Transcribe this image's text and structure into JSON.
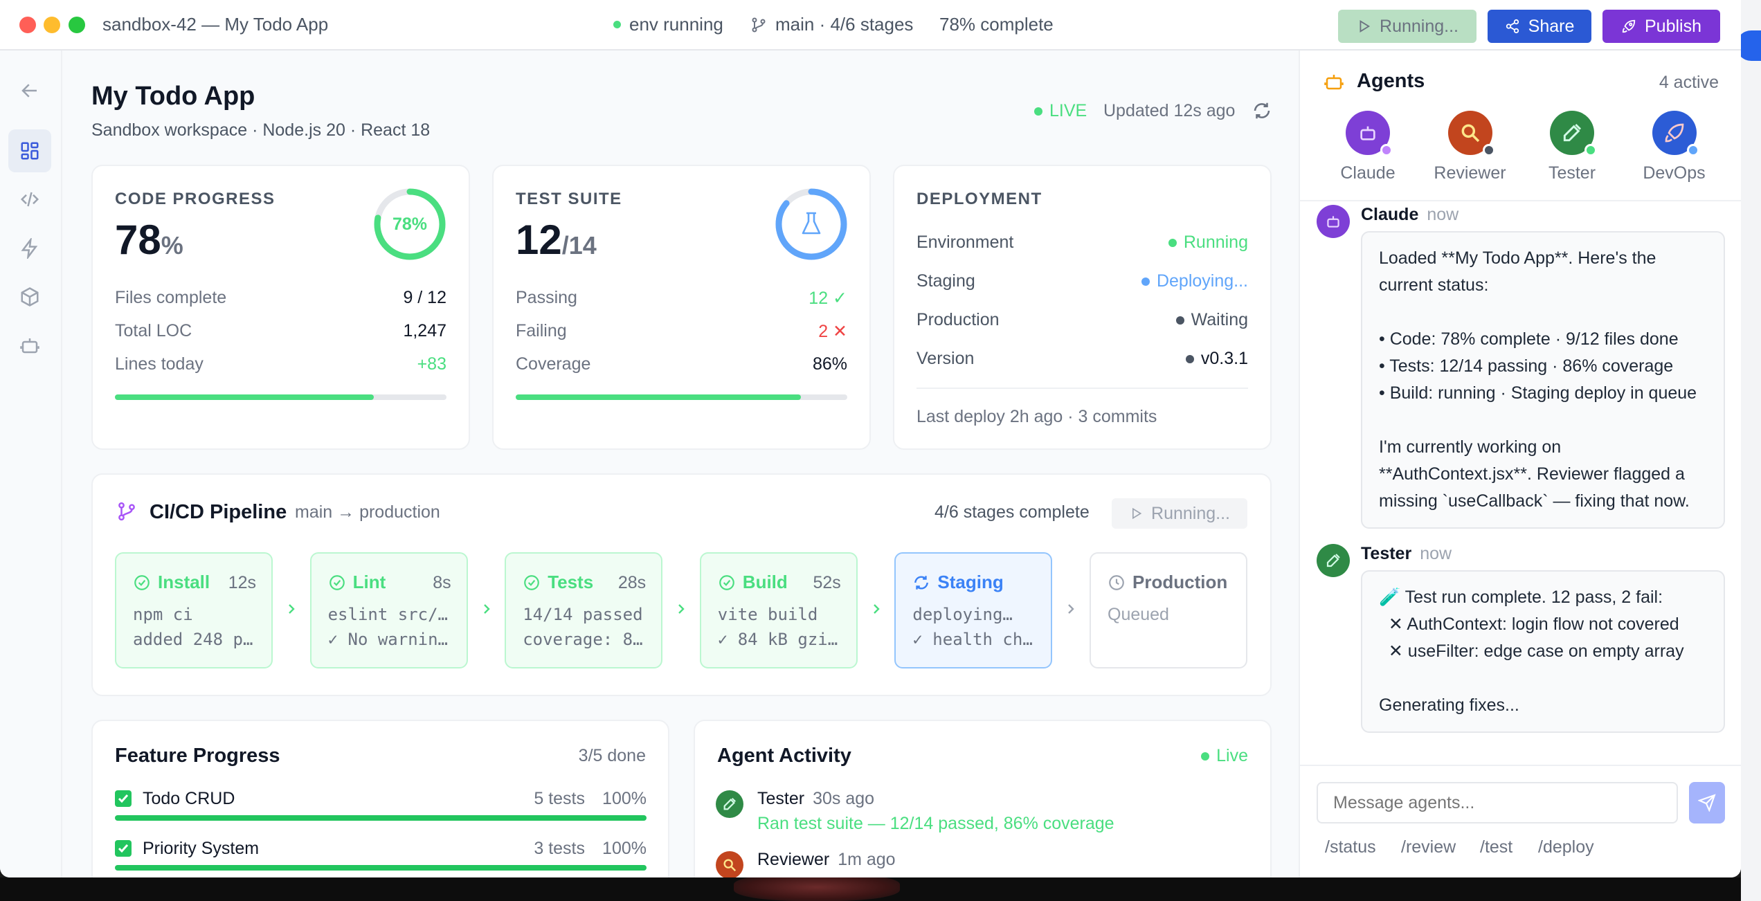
{
  "window": {
    "title": "sandbox-42 — My Todo App"
  },
  "topbar": {
    "env_status": "env running",
    "branch_status": "main · 4/6 stages",
    "completion": "78% complete",
    "running_label": "Running...",
    "share_label": "Share",
    "publish_label": "Publish"
  },
  "header": {
    "title": "My Todo App",
    "subtitle": "Sandbox workspace · Node.js 20 · React 18",
    "live_label": "LIVE",
    "updated": "Updated 12s ago"
  },
  "code_progress": {
    "label": "CODE PROGRESS",
    "value": "78",
    "unit": "%",
    "ring_label": "78%",
    "ring_fraction": 0.78,
    "rows": [
      {
        "label": "Files complete",
        "value": "9 / 12"
      },
      {
        "label": "Total LOC",
        "value": "1,247"
      },
      {
        "label": "Lines today",
        "value": "+83"
      }
    ],
    "bar_fraction": 0.78
  },
  "test_suite": {
    "label": "TEST SUITE",
    "value": "12",
    "total": "/14",
    "ring_fraction": 0.86,
    "rows": [
      {
        "label": "Passing",
        "value": "12 ✓"
      },
      {
        "label": "Failing",
        "value": "2 ✕"
      },
      {
        "label": "Coverage",
        "value": "86%"
      }
    ],
    "bar_fraction": 0.86
  },
  "deployment": {
    "label": "DEPLOYMENT",
    "rows": [
      {
        "label": "Environment",
        "value": "Running"
      },
      {
        "label": "Staging",
        "value": "Deploying..."
      },
      {
        "label": "Production",
        "value": "Waiting"
      },
      {
        "label": "Version",
        "value": "v0.3.1"
      }
    ],
    "footer": "Last deploy 2h ago · 3 commits"
  },
  "pipeline": {
    "title": "CI/CD Pipeline",
    "route": "main → production",
    "summary": "4/6 stages complete",
    "running_label": "Running...",
    "stages": [
      {
        "name": "Install",
        "time": "12s",
        "line1": "npm ci",
        "line2": "added 248 p…"
      },
      {
        "name": "Lint",
        "time": "8s",
        "line1": "eslint src/…",
        "line2": "✓ No warnin…"
      },
      {
        "name": "Tests",
        "time": "28s",
        "line1": "14/14 passed",
        "line2": "coverage: 8…"
      },
      {
        "name": "Build",
        "time": "52s",
        "line1": "vite build",
        "line2": "✓ 84 kB gzi…"
      },
      {
        "name": "Staging",
        "time": "",
        "line1": "deploying…",
        "line2": "✓ health ch…"
      },
      {
        "name": "Production",
        "time": "",
        "line1": "Queued",
        "line2": ""
      }
    ]
  },
  "features": {
    "title": "Feature Progress",
    "summary": "3/5 done",
    "items": [
      {
        "name": "Todo CRUD",
        "tests": "5 tests",
        "pct": "100%",
        "fraction": 1.0
      },
      {
        "name": "Priority System",
        "tests": "3 tests",
        "pct": "100%",
        "fraction": 1.0
      }
    ]
  },
  "activity": {
    "title": "Agent Activity",
    "live_label": "Live",
    "items": [
      {
        "agent": "Tester",
        "time": "30s ago",
        "text": "Ran test suite — 12/14 passed, 86% coverage"
      },
      {
        "agent": "Reviewer",
        "time": "1m ago",
        "text": ""
      }
    ]
  },
  "agents_panel": {
    "title": "Agents",
    "count": "4 active",
    "agents": [
      {
        "name": "Claude",
        "color": "#7e3fd6",
        "badge": "#c084fc"
      },
      {
        "name": "Reviewer",
        "color": "#c2451e",
        "badge": "#4b5563"
      },
      {
        "name": "Tester",
        "color": "#2f8a46",
        "badge": "#4ade80"
      },
      {
        "name": "DevOps",
        "color": "#2c5cd6",
        "badge": "#60a5fa"
      }
    ],
    "messages": [
      {
        "author": "Claude",
        "time": "now",
        "lines": [
          "Loaded **My Todo App**. Here's the",
          "current status:",
          "",
          "• Code: 78% complete · 9/12 files done",
          "• Tests: 12/14 passing · 86% coverage",
          "• Build: running · Staging deploy in queue",
          "",
          "I'm currently working on",
          "**AuthContext.jsx**. Reviewer flagged a",
          "missing `useCallback` — fixing that now."
        ]
      },
      {
        "author": "Tester",
        "time": "now",
        "lines": [
          "🧪 Test run complete. 12 pass, 2 fail:",
          "  ✕ AuthContext: login flow not covered",
          "  ✕ useFilter: edge case on empty array",
          "",
          "Generating fixes..."
        ]
      }
    ],
    "input_placeholder": "Message agents...",
    "quick_commands": [
      "/status",
      "/review",
      "/test",
      "/deploy"
    ]
  }
}
